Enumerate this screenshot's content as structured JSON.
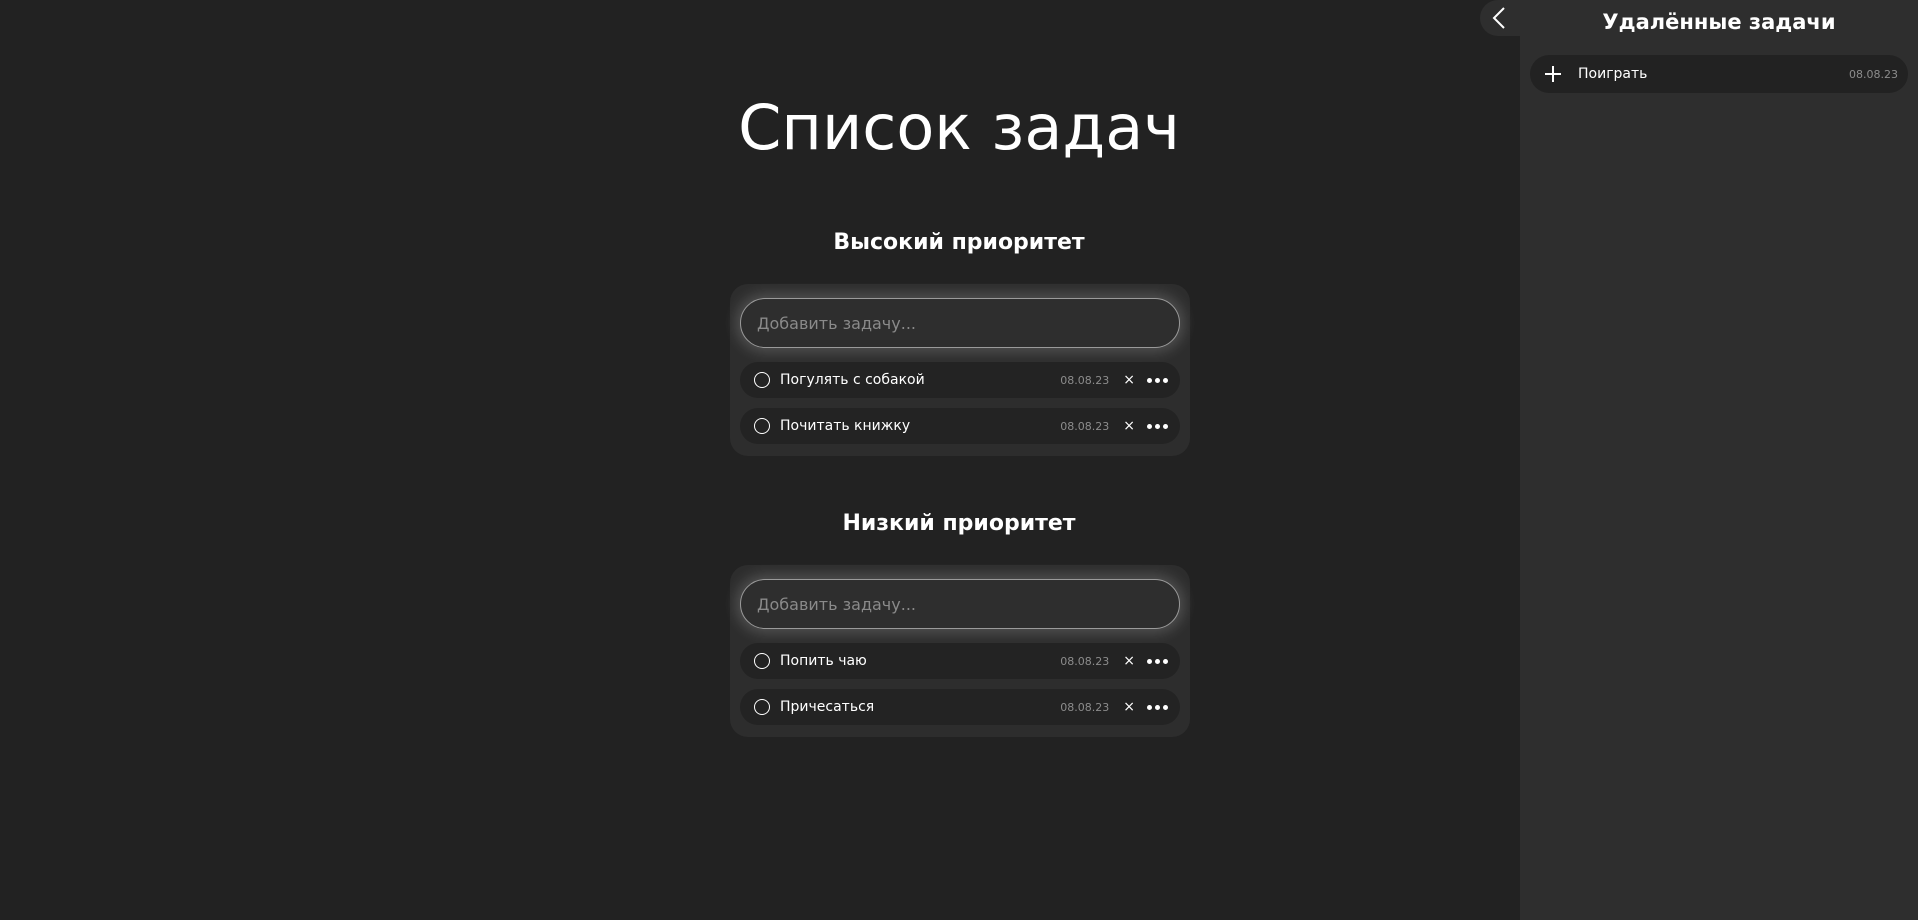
{
  "main": {
    "title": "Список задач",
    "sections": [
      {
        "title": "Высокий приоритет",
        "input_placeholder": "Добавить задачу...",
        "tasks": [
          {
            "text": "Погулять с собакой",
            "date": "08.08.23"
          },
          {
            "text": "Почитать книжку",
            "date": "08.08.23"
          }
        ]
      },
      {
        "title": "Низкий приоритет",
        "input_placeholder": "Добавить задачу...",
        "tasks": [
          {
            "text": "Попить чаю",
            "date": "08.08.23"
          },
          {
            "text": "Причесаться",
            "date": "08.08.23"
          }
        ]
      }
    ],
    "delete_label": "×"
  },
  "sidebar": {
    "title": "Удалённые задачи",
    "items": [
      {
        "text": "Поиграть",
        "date": "08.08.23"
      }
    ]
  },
  "icons": {
    "collapse": "chevron-left-icon",
    "checkbox": "circle-icon",
    "delete": "close-icon",
    "more": "more-dots-icon",
    "restore": "plus-icon"
  },
  "colors": {
    "background": "#222222",
    "panel": "#2d2d2d",
    "sidebar": "#2e2e2e",
    "muted_text": "#8c8c8c"
  }
}
